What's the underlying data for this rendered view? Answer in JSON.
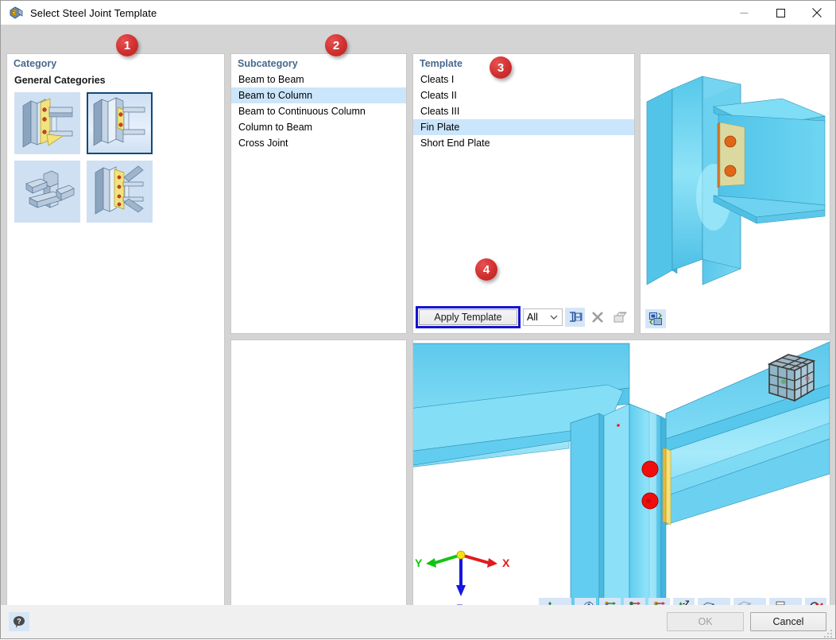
{
  "window": {
    "title": "Select Steel Joint Template",
    "icon": "steel-joint-icon",
    "minimize_label": "–",
    "maximize_label": "□",
    "close_label": "✕"
  },
  "category": {
    "title": "Category",
    "group_label": "General Categories",
    "thumbs": [
      {
        "name": "moment-end-plate-joint",
        "selected": false
      },
      {
        "name": "fin-plate-beam-to-column-joint",
        "selected": true
      },
      {
        "name": "hollow-section-cross-joint",
        "selected": false
      },
      {
        "name": "braced-gusset-joint",
        "selected": false
      }
    ]
  },
  "subcategory": {
    "title": "Subcategory",
    "items": [
      {
        "label": "Beam to Beam",
        "selected": false
      },
      {
        "label": "Beam to Column",
        "selected": true
      },
      {
        "label": "Beam to Continuous Column",
        "selected": false
      },
      {
        "label": "Column to Beam",
        "selected": false
      },
      {
        "label": "Cross Joint",
        "selected": false
      }
    ]
  },
  "template": {
    "title": "Template",
    "items": [
      {
        "label": "Cleats I",
        "selected": false
      },
      {
        "label": "Cleats II",
        "selected": false
      },
      {
        "label": "Cleats III",
        "selected": false
      },
      {
        "label": "Fin Plate",
        "selected": true
      },
      {
        "label": "Short End Plate",
        "selected": false
      }
    ],
    "apply_button": "Apply Template",
    "filter_value": "All",
    "filter_caret": "⌄",
    "tools": [
      {
        "name": "save-template-icon",
        "enabled": true
      },
      {
        "name": "delete-template-icon",
        "enabled": false
      },
      {
        "name": "rename-template-icon",
        "enabled": false
      }
    ],
    "exchange_tool": {
      "name": "exchange-view-icon",
      "enabled": true
    }
  },
  "preview": {
    "name": "fin-plate-joint-preview",
    "tool": {
      "name": "exchange-view-icon"
    }
  },
  "viewport": {
    "name": "joint-3d-viewport",
    "axes": {
      "x": "X",
      "y": "Y",
      "z": "Z"
    },
    "navcube": "navigation-cube",
    "toolbar": [
      {
        "name": "coordinate-system-icon",
        "caret": true
      },
      {
        "name": "measure-icon",
        "caret": false
      },
      {
        "name": "view-x-icon",
        "label": "X",
        "caret": false
      },
      {
        "name": "view-minus-y-icon",
        "label": "-Y",
        "caret": false
      },
      {
        "name": "view-z-icon",
        "label": "Z",
        "caret": false
      },
      {
        "name": "view-minus-z-icon",
        "label": "-Z",
        "caret": false
      },
      {
        "name": "render-mode-icon",
        "caret": true
      },
      {
        "name": "wireframe-icon",
        "caret": true
      },
      {
        "name": "print-icon",
        "caret": true
      },
      {
        "name": "zoom-reset-icon",
        "caret": false
      }
    ]
  },
  "badges": [
    {
      "number": "1",
      "target": "category-panel"
    },
    {
      "number": "2",
      "target": "subcategory-panel"
    },
    {
      "number": "3",
      "target": "template-panel"
    },
    {
      "number": "4",
      "target": "apply-template-button"
    }
  ],
  "footer": {
    "help": {
      "name": "help-icon"
    },
    "ok_label": "OK",
    "ok_enabled": false,
    "cancel_label": "Cancel",
    "cancel_enabled": true
  },
  "colors": {
    "accent_blue": "#1414d2",
    "selection": "#cbe5fb",
    "panel_header": "#46698e",
    "badge_red": "#d02f2f",
    "thumb_bg": "#cfe0f3",
    "beam_blue": "#5fcdf0",
    "plate_yellow": "#f2e37a",
    "bolt_red": "#f20d0d",
    "axis_x": "#e01b1b",
    "axis_y": "#12c412",
    "axis_z": "#1616e0"
  }
}
